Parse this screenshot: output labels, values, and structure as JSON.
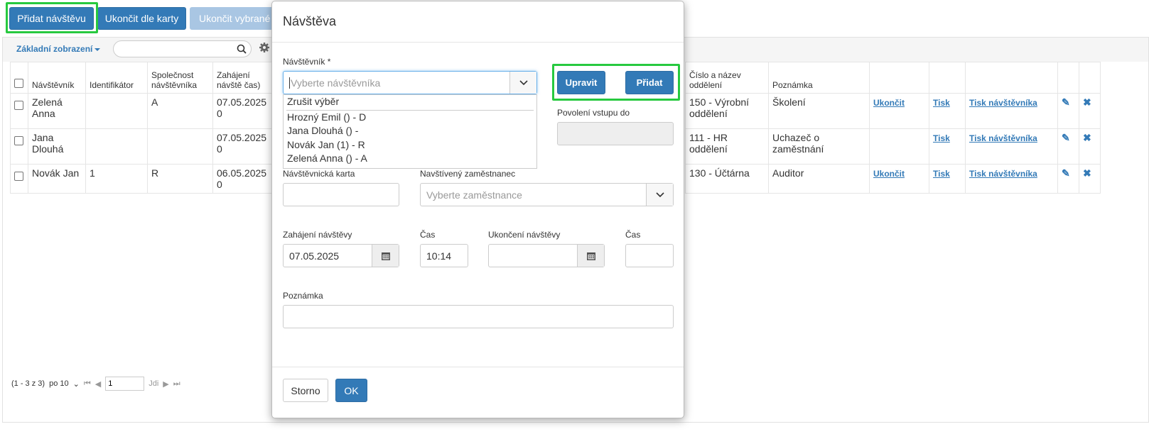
{
  "toolbar": {
    "add_visit": "Přidat návštěvu",
    "end_by_card": "Ukončit dle karty",
    "end_selected": "Ukončit vybrané"
  },
  "grid": {
    "view_label": "Základní zobrazení",
    "search_placeholder": "",
    "columns": [
      "",
      "Návštěvník",
      "Identifikátor",
      "Společnost návštěvníka",
      "Zahájení návštěvy (datum a čas)",
      "Číslo a název oddělení",
      "Poznámka"
    ],
    "header_visible": {
      "col_visitor": "Návštěvník",
      "col_identifier": "Identifikátor",
      "col_company": "Společnost návštěvníka",
      "col_start": "Zahájení návště čas)",
      "col_dept": "Číslo a název oddělení",
      "col_note": "Poznámka"
    },
    "rows": [
      {
        "visitor": "Zelená Anna",
        "identifier": "",
        "company": "A",
        "start": "07.05.2025 0",
        "dept": "150 - Výrobní oddělení",
        "note": "Školení",
        "end": "Ukončit",
        "print": "Tisk",
        "print_visitor": "Tisk návštěvníka"
      },
      {
        "visitor": "Jana Dlouhá",
        "identifier": "",
        "company": "",
        "start": "07.05.2025 0",
        "dept": "111 - HR oddělení",
        "note": "Uchazeč o zaměstnání",
        "end": "",
        "print": "Tisk",
        "print_visitor": "Tisk návštěvníka"
      },
      {
        "visitor": "Novák Jan",
        "identifier": "1",
        "company": "R",
        "start": "06.05.2025 0",
        "dept": "130 - Účtárna",
        "note": "Auditor",
        "end": "Ukončit",
        "print": "Tisk",
        "print_visitor": "Tisk návštěvníka"
      }
    ],
    "pager": {
      "range": "(1 - 3 z 3)",
      "page_size": "po 10",
      "page": "1",
      "go": "Jdi"
    }
  },
  "modal": {
    "title": "Návštěva",
    "visitor_label": "Návštěvník *",
    "visitor_placeholder": "Vyberte návštěvníka",
    "edit_button": "Upravit",
    "add_button": "Přidat",
    "dropdown_items": [
      "Zrušit výběr",
      "Hrozný Emil () - D",
      "Jana Dlouhá () -",
      "Novák Jan (1) - R",
      "Zelená Anna () - A"
    ],
    "entry_until_label": "Povolení vstupu do",
    "entry_until_value": "",
    "card_label": "Návštěvnická karta",
    "card_value": "",
    "employee_label": "Navštívený zaměstnanec",
    "employee_placeholder": "Vyberte zaměstnance",
    "start_label": "Zahájení návštěvy",
    "start_value": "07.05.2025",
    "start_time_label": "Čas",
    "start_time_value": "10:14",
    "end_label": "Ukončení návštěvy",
    "end_value": "",
    "end_time_label": "Čas",
    "end_time_value": "",
    "note_label": "Poznámka",
    "note_value": "",
    "cancel_button": "Storno",
    "ok_button": "OK"
  },
  "colors": {
    "primary": "#337ab7",
    "highlight": "#27c93f"
  }
}
